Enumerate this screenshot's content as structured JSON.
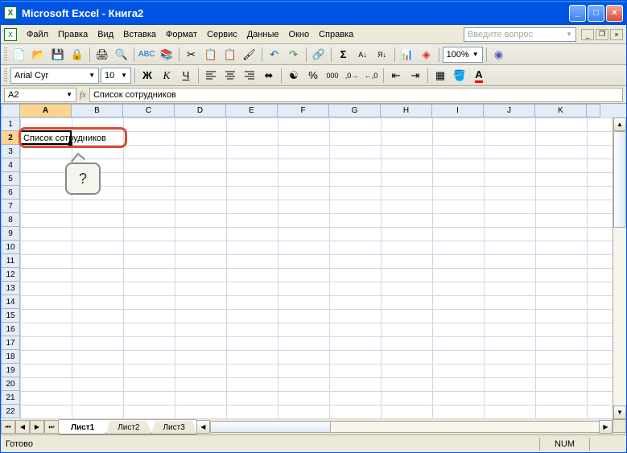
{
  "titlebar": {
    "title": "Microsoft Excel - Книга2"
  },
  "menu": {
    "file": "Файл",
    "edit": "Правка",
    "view": "Вид",
    "insert": "Вставка",
    "format": "Формат",
    "tools": "Сервис",
    "data": "Данные",
    "window": "Окно",
    "help": "Справка",
    "help_placeholder": "Введите вопрос"
  },
  "toolbar": {
    "zoom": "100%"
  },
  "format_bar": {
    "font": "Arial Cyr",
    "size": "10"
  },
  "formula": {
    "name_box": "A2",
    "fx": "fx",
    "value": "Список сотрудников"
  },
  "grid": {
    "columns": [
      "A",
      "B",
      "C",
      "D",
      "E",
      "F",
      "G",
      "H",
      "I",
      "J",
      "K"
    ],
    "active_col": "A",
    "active_row": 2,
    "row_count": 22,
    "cell_A2": "Список сотрудников"
  },
  "callout": {
    "text": "?"
  },
  "tabs": {
    "t1": "Лист1",
    "t2": "Лист2",
    "t3": "Лист3"
  },
  "status": {
    "ready": "Готово",
    "num": "NUM"
  }
}
